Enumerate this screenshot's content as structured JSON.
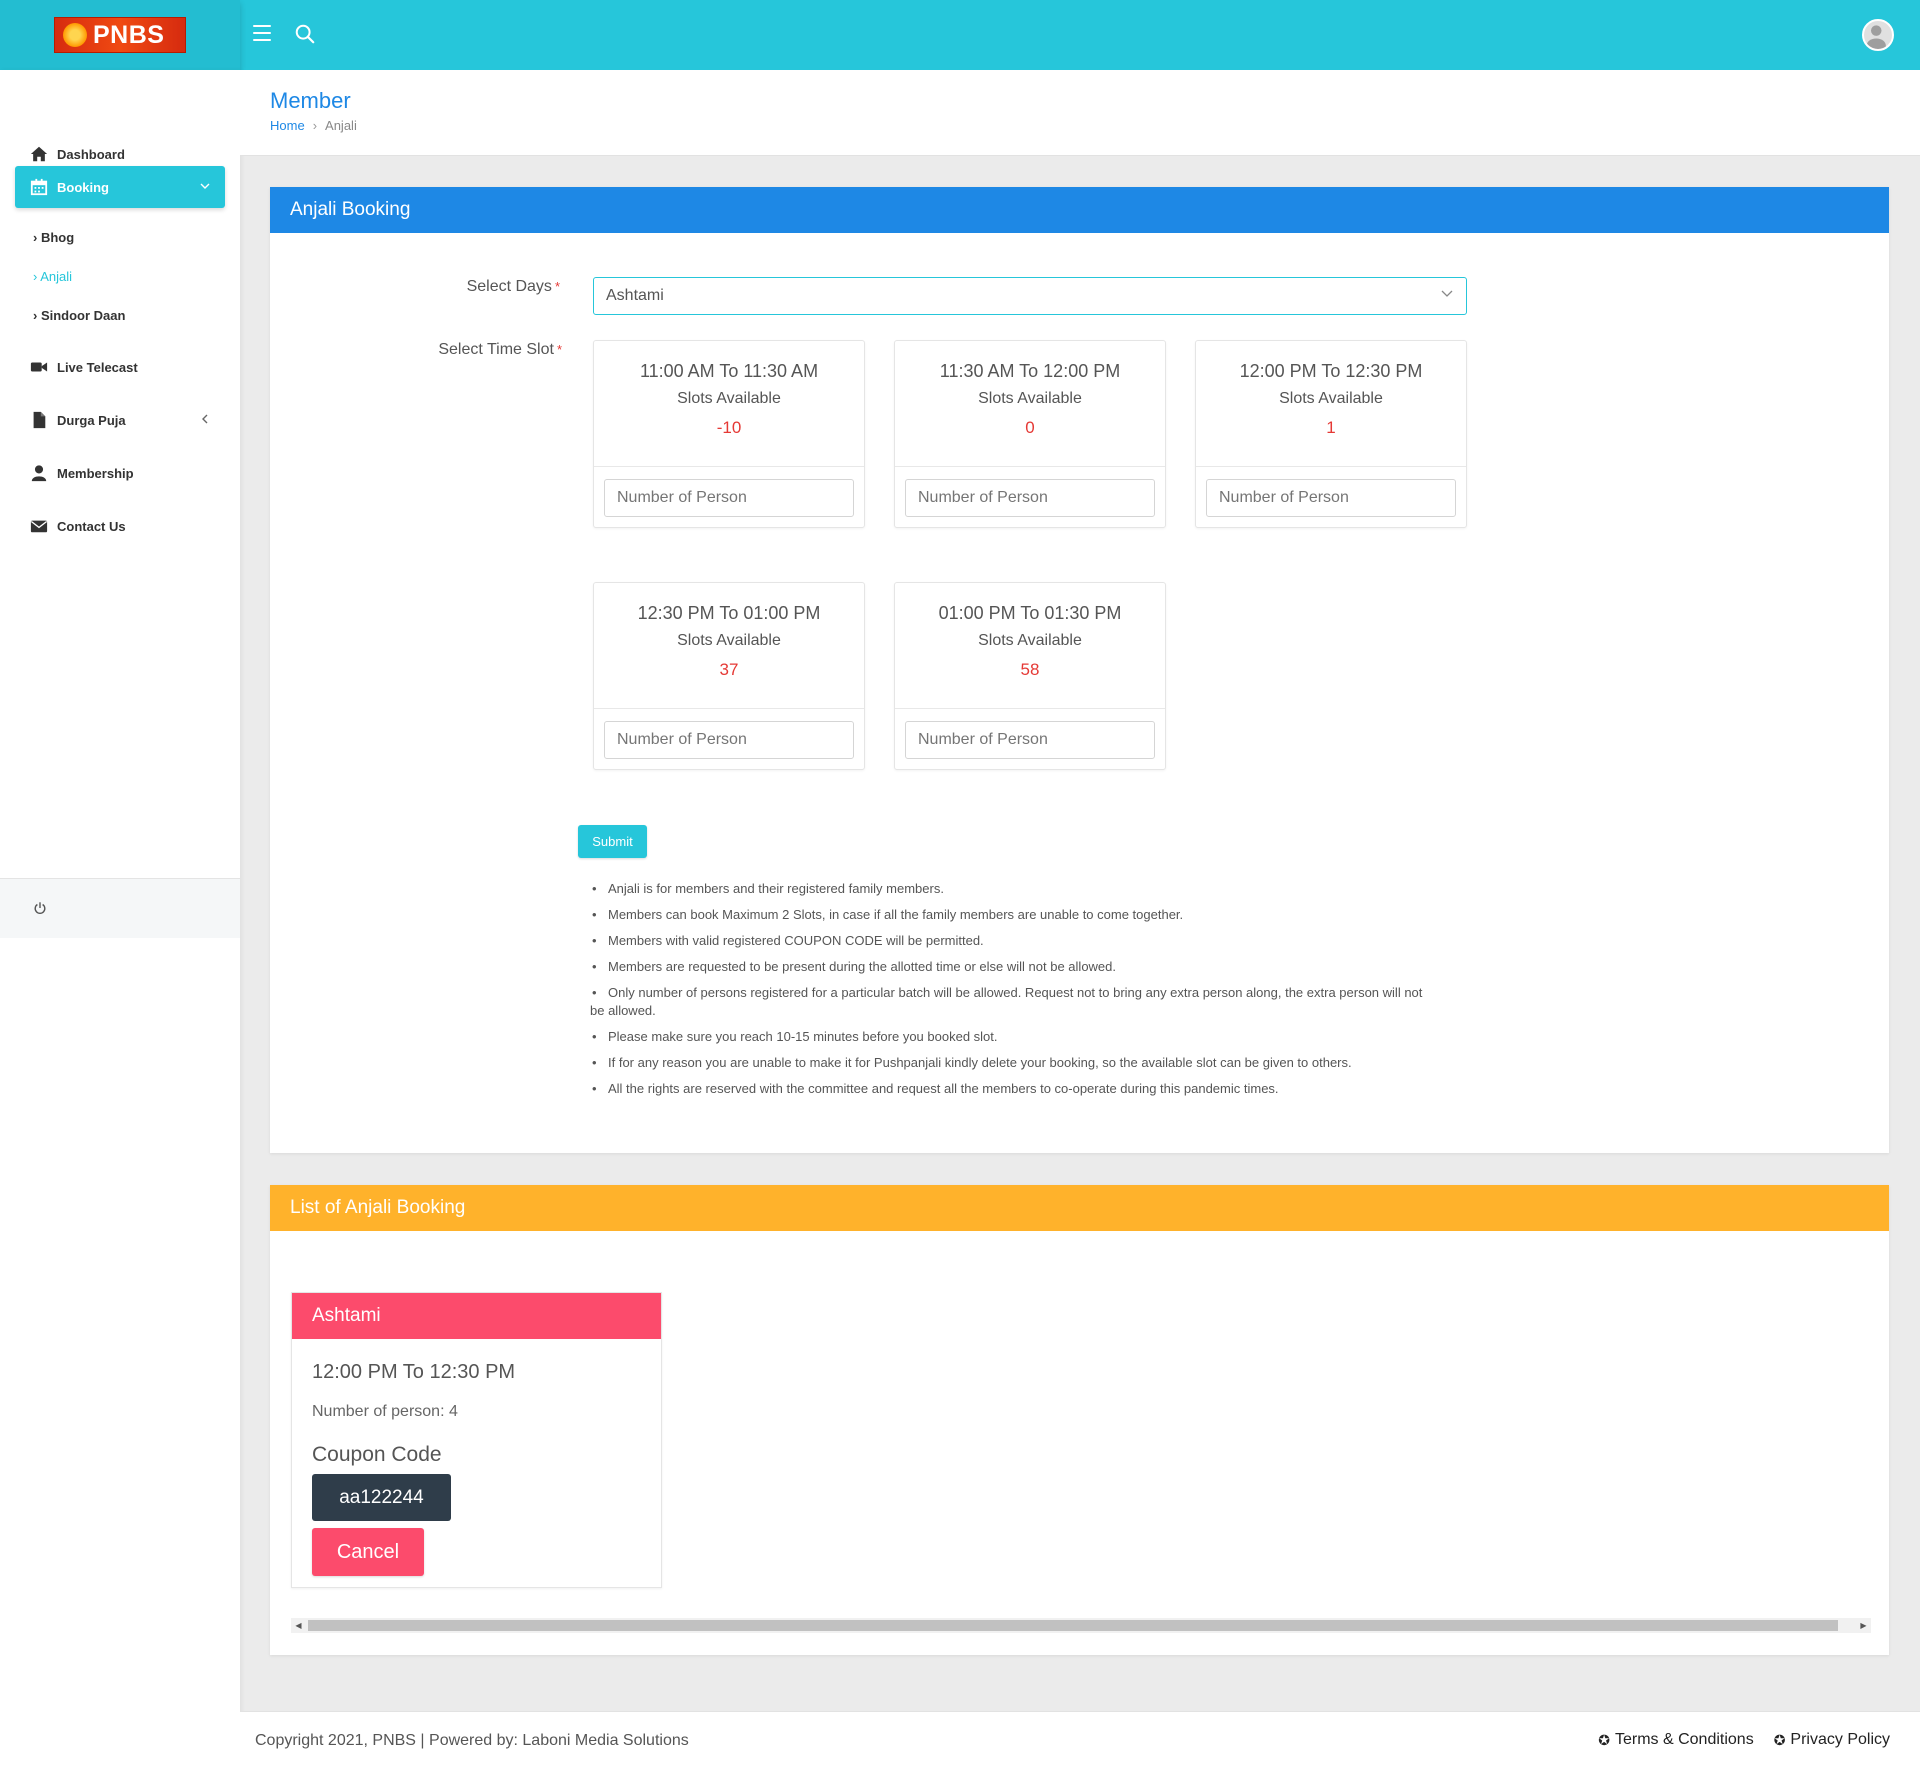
{
  "brand": {
    "logo_text": "PNBS"
  },
  "sidebar": {
    "items": [
      {
        "label": "Dashboard",
        "icon": "home-icon"
      },
      {
        "label": "Booking",
        "icon": "calendar-icon",
        "active": true
      },
      {
        "label": "Live Telecast",
        "icon": "video-icon"
      },
      {
        "label": "Durga Puja",
        "icon": "file-icon"
      },
      {
        "label": "Membership",
        "icon": "user-icon"
      },
      {
        "label": "Contact Us",
        "icon": "envelope-icon"
      }
    ],
    "sub_items": [
      {
        "label": "Bhog"
      },
      {
        "label": "Anjali",
        "active": true
      },
      {
        "label": "Sindoor Daan"
      }
    ],
    "chevron": "›"
  },
  "header": {
    "title": "Member",
    "breadcrumb": {
      "home": "Home",
      "current": "Anjali"
    }
  },
  "booking_form": {
    "title": "Anjali Booking",
    "select_days_label": "Select Days",
    "select_time_slot_label": "Select Time Slot",
    "required_mark": "*",
    "selected_day": "Ashtami",
    "slots": [
      {
        "time": "11:00 AM To 11:30 AM",
        "available_label": "Slots Available",
        "count": "-10",
        "placeholder": "Number of Person"
      },
      {
        "time": "11:30 AM To 12:00 PM",
        "available_label": "Slots Available",
        "count": "0",
        "placeholder": "Number of Person"
      },
      {
        "time": "12:00 PM To 12:30 PM",
        "available_label": "Slots Available",
        "count": "1",
        "placeholder": "Number of Person"
      },
      {
        "time": "12:30 PM To 01:00 PM",
        "available_label": "Slots Available",
        "count": "37",
        "placeholder": "Number of Person"
      },
      {
        "time": "01:00 PM To 01:30 PM",
        "available_label": "Slots Available",
        "count": "58",
        "placeholder": "Number of Person"
      }
    ],
    "submit_label": "Submit",
    "notes": [
      "Anjali is for members and their registered family members.",
      "Members can book Maximum 2 Slots, in case if all the family members are unable to come together.",
      "Members with valid registered COUPON CODE will be permitted.",
      "Members are requested to be present during the allotted time or else will not be allowed.",
      "Only number of persons registered for a particular batch will be allowed. Request not to bring any extra person along, the extra person will not be allowed.",
      "Please make sure you reach 10-15 minutes before you booked slot.",
      "If for any reason you are unable to make it for Pushpanjali kindly delete your booking, so the available slot can be given to others.",
      "All the rights are reserved with the committee and request all the members to co-operate during this pandemic times."
    ]
  },
  "booking_list": {
    "title": "List of Anjali Booking",
    "bookings": [
      {
        "day": "Ashtami",
        "time": "12:00 PM To 12:30 PM",
        "persons": "Number of person: 4",
        "coupon_label": "Coupon Code",
        "coupon": "aa122244",
        "cancel_label": "Cancel"
      }
    ]
  },
  "footer": {
    "copyright": "Copyright 2021, PNBS | Powered by: Laboni Media Solutions",
    "links": [
      "Terms & Conditions",
      "Privacy Policy"
    ]
  },
  "colors": {
    "topbar": "#26c6da",
    "primary": "#1e88e5",
    "amber": "#ffb22b",
    "danger": "#fc4b6c",
    "dark": "#2f3d4a",
    "slot_count": "#e53935"
  }
}
